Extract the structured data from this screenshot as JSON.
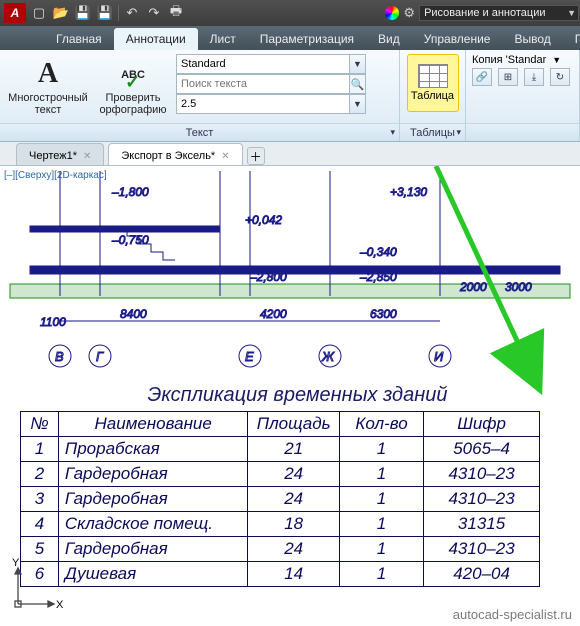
{
  "qat": {
    "icons": [
      "new",
      "open",
      "save",
      "saveas",
      "undo",
      "redo",
      "print"
    ]
  },
  "workspace": {
    "label": "Рисование и аннотации"
  },
  "ribbon_tabs": [
    "Главная",
    "Аннотации",
    "Лист",
    "Параметризация",
    "Вид",
    "Управление",
    "Вывод",
    "Подкл"
  ],
  "ribbon_active_index": 1,
  "text_panel": {
    "mtext_glyph": "A",
    "mtext_label": "Многострочный текст",
    "spell_abc": "ABC",
    "spell_label": "Проверить орфографию",
    "style": "Standard",
    "search_placeholder": "Поиск текста",
    "height": "2.5",
    "title": "Текст"
  },
  "table_panel": {
    "btn_label": "Таблица",
    "extra_label": "Копия 'Standar",
    "title": "Таблицы"
  },
  "file_tabs": [
    {
      "label": "Чертеж1*",
      "active": false
    },
    {
      "label": "Экспорт в Эксель*",
      "active": true
    }
  ],
  "viewport_label": "[–][Сверху][2D-каркас]",
  "section_values": {
    "elev1": "+3,130",
    "elev2": "+0,042",
    "elev3": "–0,340",
    "dim1": "–1,800",
    "dim2": "–0,750",
    "dimA": "–2,800",
    "dimB": "–2,850",
    "dimR": "2000",
    "dimR2": "3000",
    "dimL": "1100",
    "span1": "8400",
    "span2": "4200",
    "span3": "6300",
    "ax1": "В",
    "ax2": "Г",
    "ax3": "Е",
    "ax4": "Ж",
    "ax5": "И"
  },
  "table": {
    "caption": "Экспликация временных зданий",
    "headers": [
      "№",
      "Наименование",
      "Площадь",
      "Кол-во",
      "Шифр"
    ],
    "rows": [
      [
        "1",
        "Прорабская",
        "21",
        "1",
        "5065–4"
      ],
      [
        "2",
        "Гардеробная",
        "24",
        "1",
        "4310–23"
      ],
      [
        "3",
        "Гардеробная",
        "24",
        "1",
        "4310–23"
      ],
      [
        "4",
        "Складское помещ.",
        "18",
        "1",
        "31315"
      ],
      [
        "5",
        "Гардеробная",
        "24",
        "1",
        "4310–23"
      ],
      [
        "6",
        "Душевая",
        "14",
        "1",
        "420–04"
      ]
    ]
  },
  "ucs_labels": {
    "x": "X",
    "y": "Y"
  },
  "watermark": "autocad-specialist.ru"
}
